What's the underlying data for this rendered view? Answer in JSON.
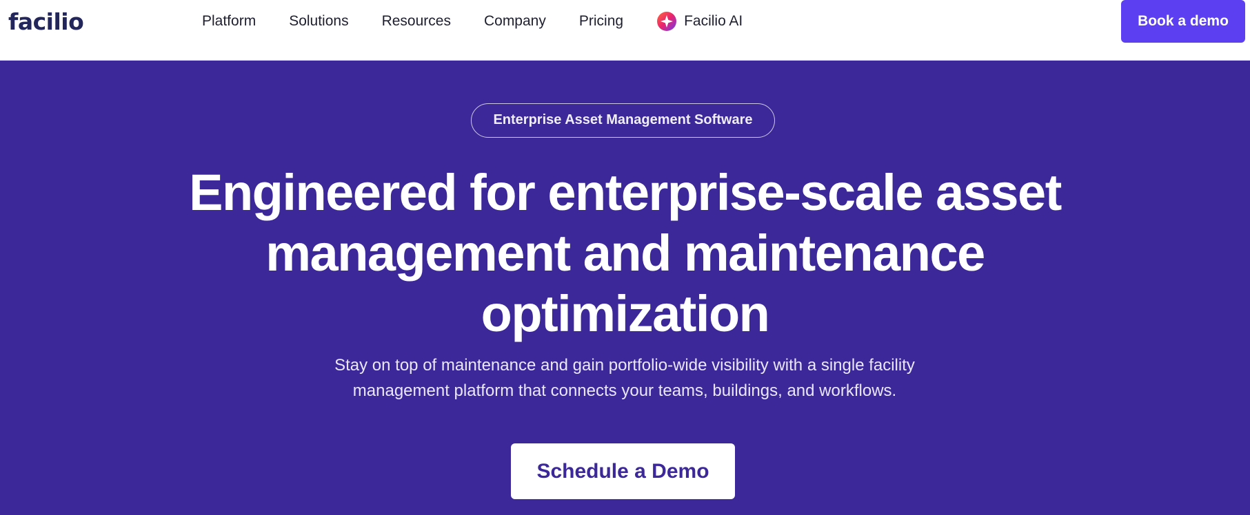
{
  "brand": {
    "logo_text": "facilio",
    "logo_color": "#23265a",
    "accent": "#5b3ff0",
    "hero_background": "#3c2898"
  },
  "nav": {
    "items": [
      {
        "label": "Platform"
      },
      {
        "label": "Solutions"
      },
      {
        "label": "Resources"
      },
      {
        "label": "Company"
      },
      {
        "label": "Pricing"
      }
    ],
    "ai": {
      "label": "Facilio AI",
      "icon": "sparkle-icon"
    },
    "cta_label": "Book a demo"
  },
  "hero": {
    "badge": "Enterprise Asset Management Software",
    "headline_lines": [
      "Engineered for enterprise-scale asset",
      "management and maintenance",
      "optimization"
    ],
    "subtext_lines": [
      "Stay on top of maintenance and gain portfolio-wide visibility with a single facility",
      "management platform that connects your teams, buildings, and workflows."
    ],
    "cta_label": "Schedule a Demo"
  }
}
